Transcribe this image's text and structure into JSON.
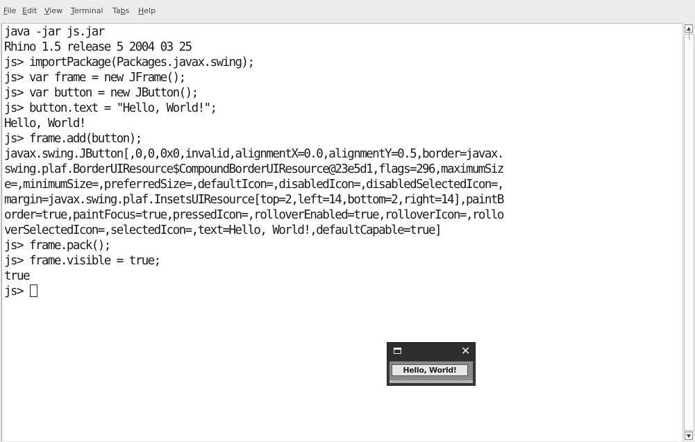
{
  "menu": {
    "items": [
      {
        "before": "",
        "mnemonic": "F",
        "after": "ile"
      },
      {
        "before": "",
        "mnemonic": "E",
        "after": "dit"
      },
      {
        "before": "",
        "mnemonic": "V",
        "after": "iew"
      },
      {
        "before": "",
        "mnemonic": "T",
        "after": "erminal"
      },
      {
        "before": "Ta",
        "mnemonic": "b",
        "after": "s"
      },
      {
        "before": "",
        "mnemonic": "H",
        "after": "elp"
      }
    ]
  },
  "terminal": {
    "lines": [
      "java -jar js.jar",
      "Rhino 1.5 release 5 2004 03 25",
      "js> importPackage(Packages.javax.swing);",
      "js> var frame = new JFrame();",
      "js> var button = new JButton();",
      "js> button.text = \"Hello, World!\";",
      "Hello, World!",
      "js> frame.add(button);",
      "javax.swing.JButton[,0,0,0x0,invalid,alignmentX=0.0,alignmentY=0.5,border=javax.",
      "swing.plaf.BorderUIResource$CompoundBorderUIResource@23e5d1,flags=296,maximumSiz",
      "e=,minimumSize=,preferredSize=,defaultIcon=,disabledIcon=,disabledSelectedIcon=,",
      "margin=javax.swing.plaf.InsetsUIResource[top=2,left=14,bottom=2,right=14],paintB",
      "order=true,paintFocus=true,pressedIcon=,rolloverEnabled=true,rolloverIcon=,rollo",
      "verSelectedIcon=,selectedIcon=,text=Hello, World!,defaultCapable=true]",
      "js> frame.pack();",
      "js> frame.visible = true;",
      "true"
    ],
    "prompt": "js> "
  },
  "jframe": {
    "button_label": "Hello, World!",
    "max_icon": "maximize-icon",
    "close_icon": "close-icon",
    "close_glyph": "✕"
  },
  "scrollbar": {
    "up_icon": "scroll-up-arrow-icon",
    "down_icon": "scroll-down-arrow-icon"
  },
  "colors": {
    "terminal_bg": "#ffffff",
    "terminal_text": "#1a1a1a",
    "menubar_bg": "#ececec",
    "jframe_title_bg": "#2e2e2e",
    "jframe_button_bg": "#e6e6e6"
  }
}
